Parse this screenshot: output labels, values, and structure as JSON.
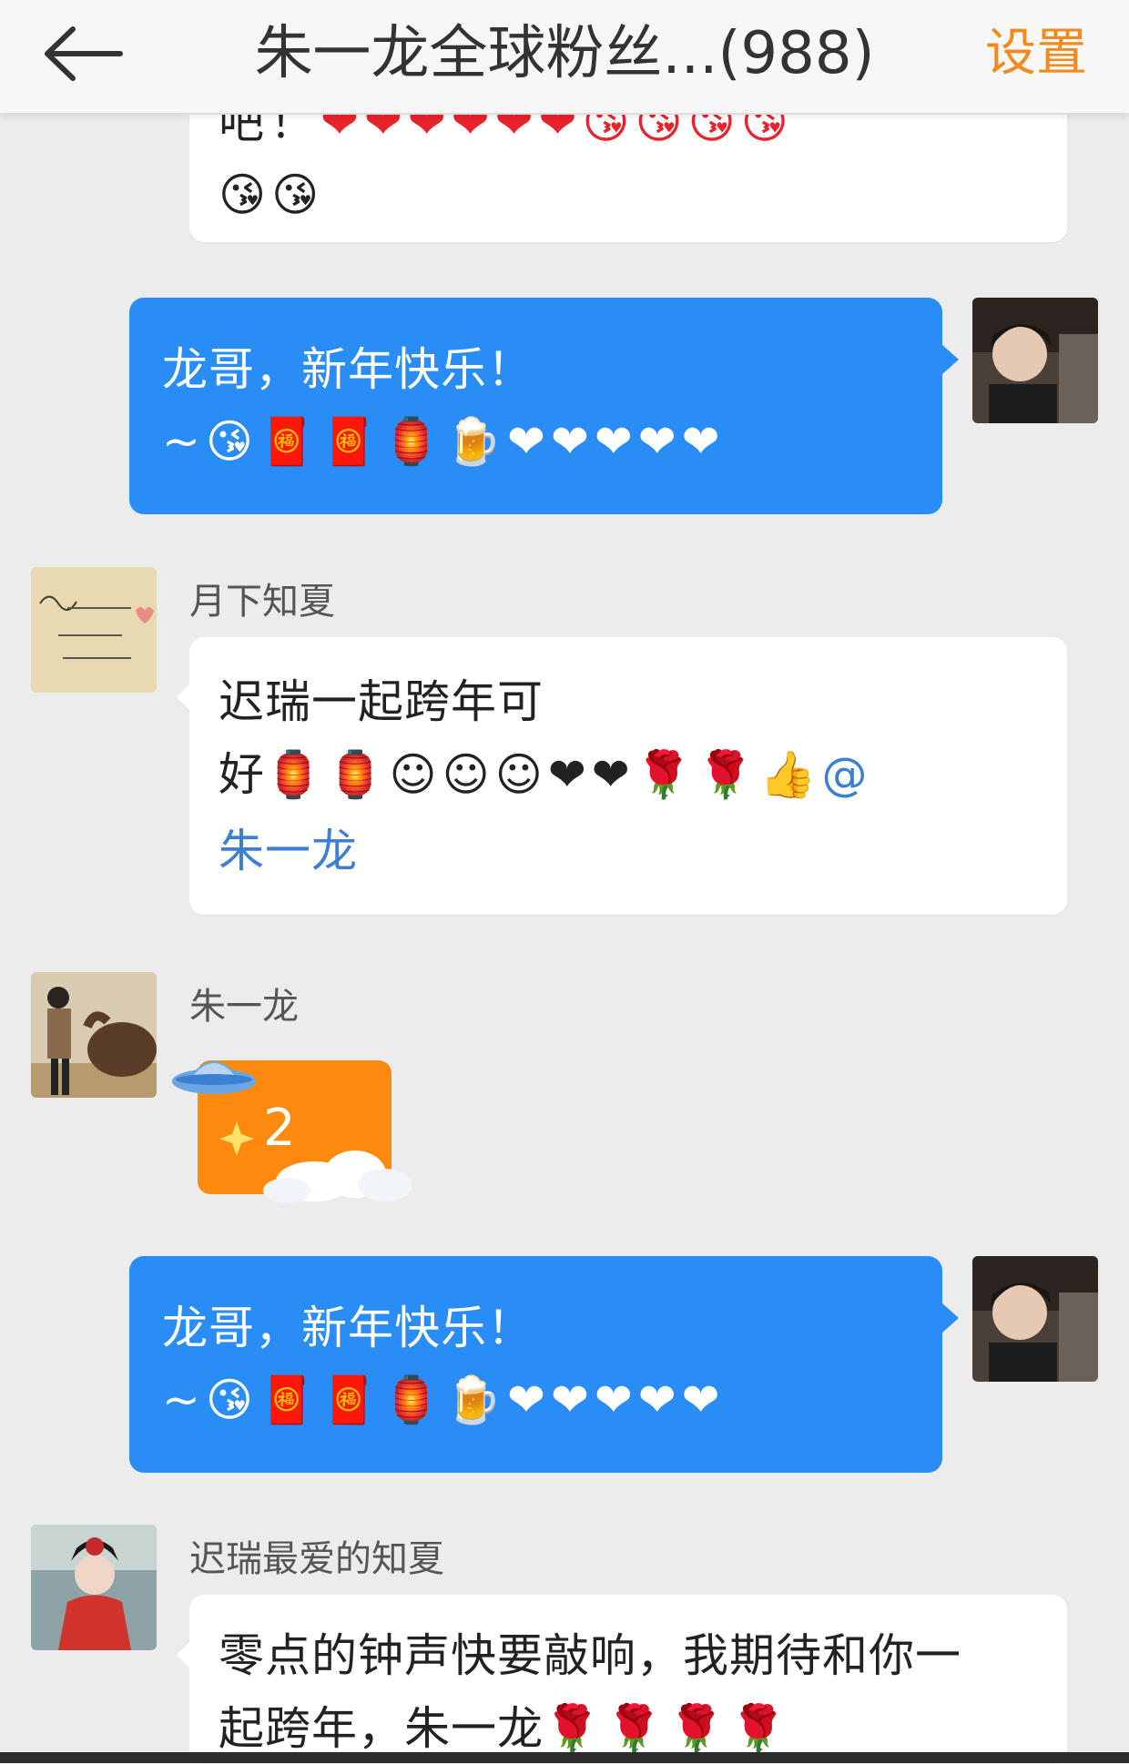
{
  "header": {
    "title": "朱一龙全球粉丝...(988)",
    "settings_label": "设置"
  },
  "messages": [
    {
      "id": "m0",
      "side": "left",
      "partial": true,
      "text_top": "吧！",
      "emojis_top": "❤❤❤❤❤❤😘😘😘😘",
      "emojis_bottom": "😘😘"
    },
    {
      "id": "m1",
      "side": "right",
      "line1": "龙哥，新年快乐！",
      "line2_prefix": "~",
      "emojis": "😘🧧🧧🏮🍺❤❤❤❤❤"
    },
    {
      "id": "m2",
      "side": "left",
      "sender": "月下知夏",
      "line1": "迟瑞一起跨年可",
      "line2_prefix": "好",
      "emojis": "🏮🏮☺☺☺❤❤🌹🌹👍",
      "mention_at": "@",
      "mention_name": "朱一龙"
    },
    {
      "id": "m3",
      "side": "left",
      "sender": "朱一龙",
      "card_number": "2"
    },
    {
      "id": "m4",
      "side": "right",
      "line1": "龙哥，新年快乐！",
      "line2_prefix": "~",
      "emojis": "😘🧧🧧🏮🍺❤❤❤❤❤"
    },
    {
      "id": "m5",
      "side": "left",
      "sender": "迟瑞最爱的知夏",
      "line1": "零点的钟声快要敲响，我期待和你一",
      "line2": "起跨年，朱一龙",
      "emojis": "🌹🌹🌹🌹"
    }
  ],
  "colors": {
    "accent_orange": "#f28a1d",
    "outgoing_bubble": "#2a8cf5",
    "mention_blue": "#3d7fd0",
    "background": "#ececec"
  }
}
